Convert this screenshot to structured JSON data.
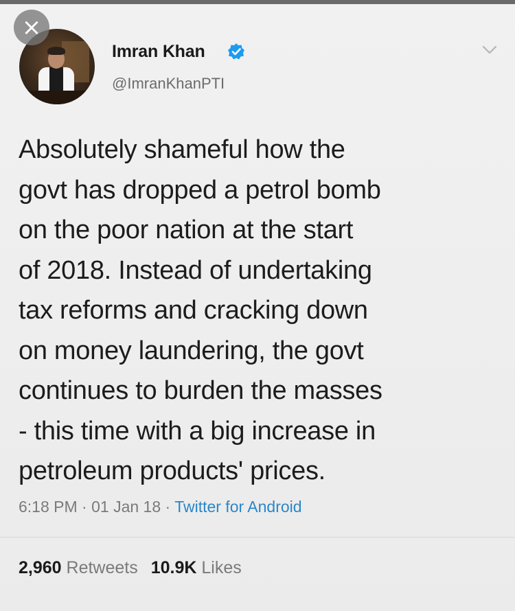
{
  "user": {
    "display_name": "Imran Khan",
    "handle": "@ImranKhanPTI",
    "verified": true
  },
  "tweet": {
    "lines": [
      "Absolutely shameful how the",
      "govt has dropped a petrol bomb",
      "on the poor nation at the start",
      "of 2018. Instead  of undertaking",
      "tax reforms and cracking down",
      "on money laundering, the govt",
      "continues to burden the masses",
      "- this time with a big increase in",
      "petroleum products' prices."
    ],
    "time": "6:18 PM",
    "date": "01 Jan 18",
    "source": "Twitter for Android",
    "separator": "·"
  },
  "stats": {
    "retweets_count": "2,960",
    "retweets_label": "Retweets",
    "likes_count": "10.9K",
    "likes_label": "Likes"
  },
  "icons": {
    "close": "close-icon",
    "verified": "verified-badge-icon",
    "more": "chevron-down-icon"
  },
  "colors": {
    "verified_badge": "#1d9bf0",
    "source_link": "#2a86c8",
    "close_bg": "#787878"
  }
}
